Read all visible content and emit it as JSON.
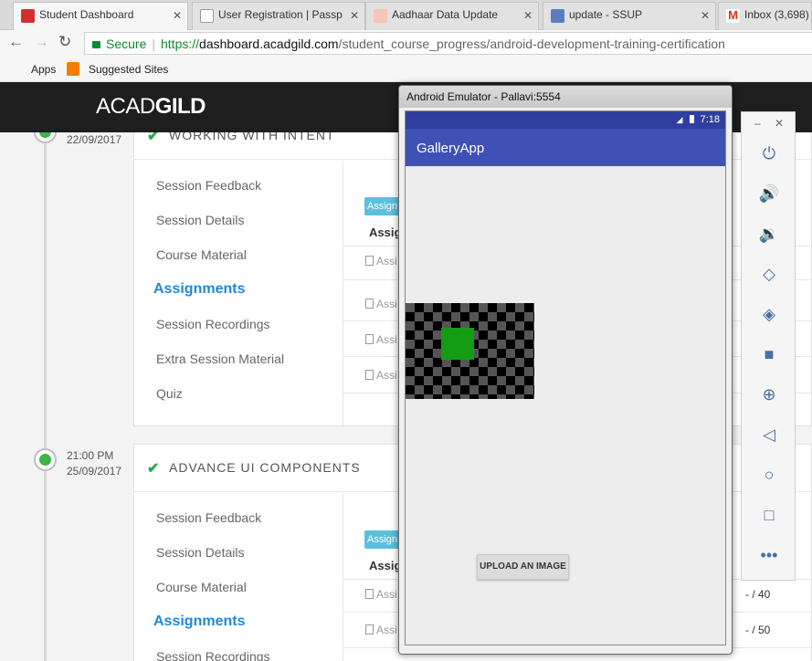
{
  "browser": {
    "tabs": [
      {
        "label": "Student Dashboard",
        "color": "#d32f2f"
      },
      {
        "label": "User Registration | Passp",
        "color": "#999999"
      },
      {
        "label": "Aadhaar Data Update",
        "color": "#e57373"
      },
      {
        "label": "update - SSUP",
        "color": "#5c7cbf"
      },
      {
        "label": "Inbox (3,698)",
        "color": "#d93025"
      }
    ],
    "secure_label": "Secure",
    "url_scheme": "https://",
    "url_host": "dashboard.acadgild.com",
    "url_path": "/student_course_progress/android-development-training-certification",
    "bookmarks": {
      "apps": "Apps",
      "suggested": "Suggested Sites"
    }
  },
  "site": {
    "logo_light": "ACAD",
    "logo_bold": "GILD"
  },
  "sessions": [
    {
      "time": "",
      "date": "22/09/2017",
      "title": "WORKING WITH INTENT",
      "menu": [
        "Session Feedback",
        "Session Details",
        "Course Material",
        "Assignments",
        "Session Recordings",
        "Extra Session Material",
        "Quiz"
      ],
      "badge": "Assign",
      "th": "Assig",
      "rows": [
        "Assi",
        "Assi",
        "Assi",
        "Assi"
      ]
    },
    {
      "time": "21:00 PM",
      "date": "25/09/2017",
      "title": "ADVANCE UI COMPONENTS",
      "menu": [
        "Session Feedback",
        "Session Details",
        "Course Material",
        "Assignments",
        "Session Recordings"
      ],
      "badge": "Assign",
      "th": "Assig",
      "rows": [
        "Assi",
        "Assi"
      ],
      "scores": [
        "- / 40",
        "- / 50"
      ]
    }
  ],
  "emulator": {
    "title": "Android Emulator - Pallavi:5554",
    "clock": "7:18",
    "app_title": "GalleryApp",
    "upload_button": "UPLOAD AN IMAGE",
    "side_controls": [
      "power",
      "volume-up",
      "volume-down",
      "rotate-left",
      "rotate-right",
      "camera",
      "zoom",
      "back",
      "home",
      "overview",
      "more"
    ]
  }
}
